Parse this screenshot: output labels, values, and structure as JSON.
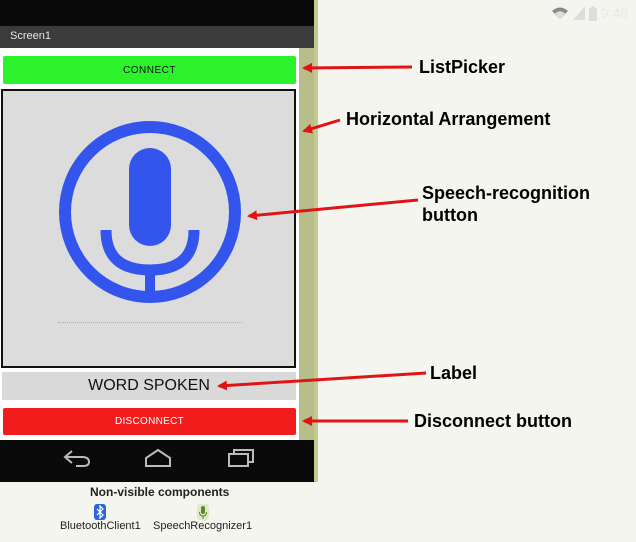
{
  "phone": {
    "status_time": "9:48",
    "screen_title": "Screen1",
    "connect_label": "CONNECT",
    "word_label": "WORD SPOKEN",
    "disconnect_label": "DISCONNECT"
  },
  "non_visible": {
    "title": "Non-visible components",
    "items": [
      {
        "label": "BluetoothClient1",
        "icon": "bluetooth-icon"
      },
      {
        "label": "SpeechRecognizer1",
        "icon": "speech-recognizer-icon"
      }
    ]
  },
  "annotations": {
    "listpicker": "ListPicker",
    "horizontal": "Horizontal Arrangement",
    "speech_line1": "Speech-recognition",
    "speech_line2": "button",
    "label": "Label",
    "disconnect": "Disconnect button"
  },
  "colors": {
    "connect": "#2cf22c",
    "disconnect": "#f21c1c",
    "mic": "#3355ee",
    "arrow": "#e01414",
    "arrangement_bg": "#dcdcdc"
  }
}
